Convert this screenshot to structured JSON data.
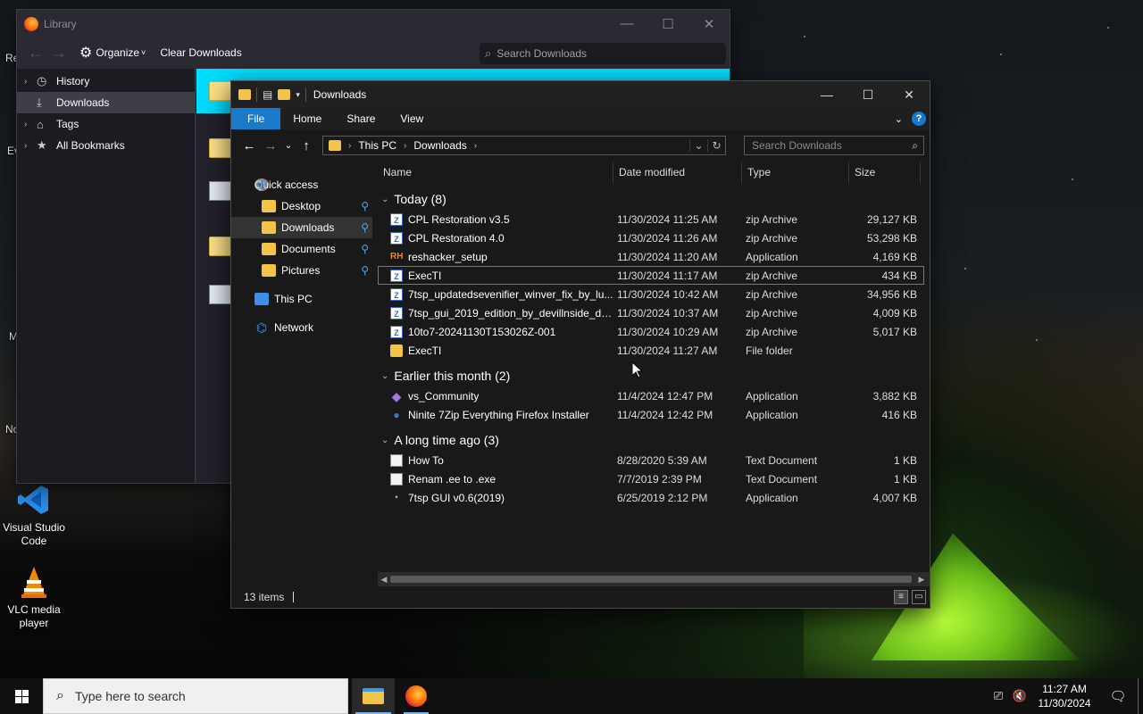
{
  "desktop": {
    "icons": [
      {
        "label": "Visual Studio Code",
        "icon": "vscode-icon"
      },
      {
        "label": "VLC media player",
        "icon": "vlc-icon"
      }
    ],
    "peek_labels": [
      "Re",
      "Ev",
      "M",
      "No"
    ]
  },
  "library": {
    "title": "Library",
    "window_controls": {
      "minimize": "—",
      "maximize": "☐",
      "close": "✕"
    },
    "toolbar": {
      "organize": "Organize",
      "organize_caret": "˅",
      "clear_downloads": "Clear Downloads"
    },
    "search": {
      "placeholder": "Search Downloads"
    },
    "tree": [
      {
        "label": "History",
        "icon": "clock-icon",
        "expandable": true,
        "selected": false
      },
      {
        "label": "Downloads",
        "icon": "download-icon",
        "expandable": false,
        "selected": true
      },
      {
        "label": "Tags",
        "icon": "tag-icon",
        "expandable": true,
        "selected": false
      },
      {
        "label": "All Bookmarks",
        "icon": "star-icon",
        "expandable": true,
        "selected": false
      }
    ]
  },
  "explorer": {
    "title": "Downloads",
    "ribbon_tabs": [
      "File",
      "Home",
      "Share",
      "View"
    ],
    "help": "?",
    "address": {
      "segments": [
        "This PC",
        "Downloads"
      ]
    },
    "search": {
      "placeholder": "Search Downloads"
    },
    "nav_pane": [
      {
        "label": "Quick access",
        "icon": "star",
        "pinned": false,
        "indent": 26,
        "selected": false
      },
      {
        "label": "Desktop",
        "icon": "folder",
        "pinned": true,
        "indent": 34,
        "selected": false
      },
      {
        "label": "Downloads",
        "icon": "folder",
        "pinned": true,
        "indent": 34,
        "selected": true
      },
      {
        "label": "Documents",
        "icon": "folder",
        "pinned": true,
        "indent": 34,
        "selected": false
      },
      {
        "label": "Pictures",
        "icon": "folder",
        "pinned": true,
        "indent": 34,
        "selected": false
      },
      {
        "label": "This PC",
        "icon": "pc",
        "pinned": false,
        "indent": 26,
        "selected": false
      },
      {
        "label": "Network",
        "icon": "net",
        "pinned": false,
        "indent": 26,
        "selected": false
      }
    ],
    "columns": {
      "name": "Name",
      "date": "Date modified",
      "type": "Type",
      "size": "Size"
    },
    "groups": [
      {
        "label": "Today (8)",
        "rows": [
          {
            "name": "CPL Restoration v3.5",
            "date": "11/30/2024 11:25 AM",
            "type": "zip Archive",
            "size": "29,127 KB",
            "icon": "zip"
          },
          {
            "name": "CPL Restoration 4.0",
            "date": "11/30/2024 11:26 AM",
            "type": "zip Archive",
            "size": "53,298 KB",
            "icon": "zip"
          },
          {
            "name": "reshacker_setup",
            "date": "11/30/2024 11:20 AM",
            "type": "Application",
            "size": "4,169 KB",
            "icon": "rh"
          },
          {
            "name": "ExecTI",
            "date": "11/30/2024 11:17 AM",
            "type": "zip Archive",
            "size": "434 KB",
            "icon": "zip",
            "selected": true
          },
          {
            "name": "7tsp_updatedsevenifier_winver_fix_by_lu...",
            "date": "11/30/2024 10:42 AM",
            "type": "zip Archive",
            "size": "34,956 KB",
            "icon": "zip"
          },
          {
            "name": "7tsp_gui_2019_edition_by_devillnside_dd...",
            "date": "11/30/2024 10:37 AM",
            "type": "zip Archive",
            "size": "4,009 KB",
            "icon": "zip"
          },
          {
            "name": "10to7-20241130T153026Z-001",
            "date": "11/30/2024 10:29 AM",
            "type": "zip Archive",
            "size": "5,017 KB",
            "icon": "zip"
          },
          {
            "name": "ExecTI",
            "date": "11/30/2024 11:27 AM",
            "type": "File folder",
            "size": "",
            "icon": "fold"
          }
        ]
      },
      {
        "label": "Earlier this month (2)",
        "rows": [
          {
            "name": "vs_Community",
            "date": "11/4/2024 12:47 PM",
            "type": "Application",
            "size": "3,882 KB",
            "icon": "vs"
          },
          {
            "name": "Ninite 7Zip Everything Firefox Installer",
            "date": "11/4/2024 12:42 PM",
            "type": "Application",
            "size": "416 KB",
            "icon": "nin"
          }
        ]
      },
      {
        "label": "A long time ago (3)",
        "rows": [
          {
            "name": "How To",
            "date": "8/28/2020 5:39 AM",
            "type": "Text Document",
            "size": "1 KB",
            "icon": "txt"
          },
          {
            "name": "Renam .ee to .exe",
            "date": "7/7/2019 2:39 PM",
            "type": "Text Document",
            "size": "1 KB",
            "icon": "txt"
          },
          {
            "name": "7tsp GUI v0.6(2019)",
            "date": "6/25/2019 2:12 PM",
            "type": "Application",
            "size": "4,007 KB",
            "icon": "app"
          }
        ]
      }
    ],
    "status": {
      "items": "13 items"
    }
  },
  "taskbar": {
    "search_placeholder": "Type here to search",
    "clock": {
      "time": "11:27 AM",
      "date": "11/30/2024"
    }
  }
}
